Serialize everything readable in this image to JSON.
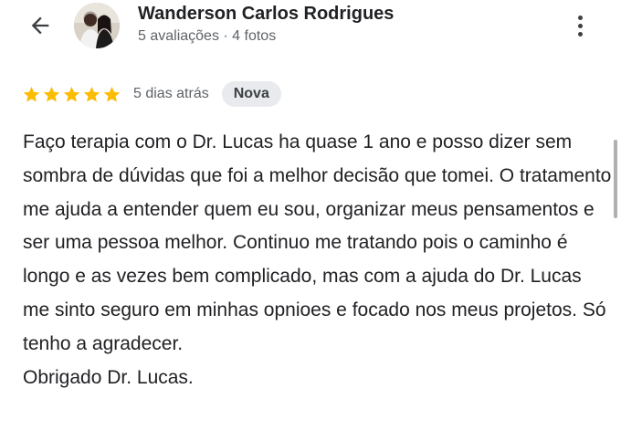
{
  "header": {
    "back_icon": "arrow-left-icon",
    "author_name": "Wanderson Carlos Rodrigues",
    "author_meta": "5 avaliações · 4 fotos",
    "more_icon": "more-vert-icon"
  },
  "review": {
    "rating": 5,
    "max_rating": 5,
    "star_color": "#FBBC04",
    "time_ago": "5 dias atrás",
    "badge": "Nova",
    "text": "Faço terapia com o Dr. Lucas ha quase 1 ano e posso dizer sem sombra de dúvidas que foi a melhor decisão que tomei. O tratamento me ajuda a entender quem eu sou, organizar meus pensamentos e ser uma pessoa melhor. Continuo me tratando pois o caminho é longo e as vezes bem complicado, mas com a ajuda do Dr. Lucas me sinto seguro em minhas opnioes e focado nos meus projetos. Só tenho a agradecer.\nObrigado Dr. Lucas."
  }
}
